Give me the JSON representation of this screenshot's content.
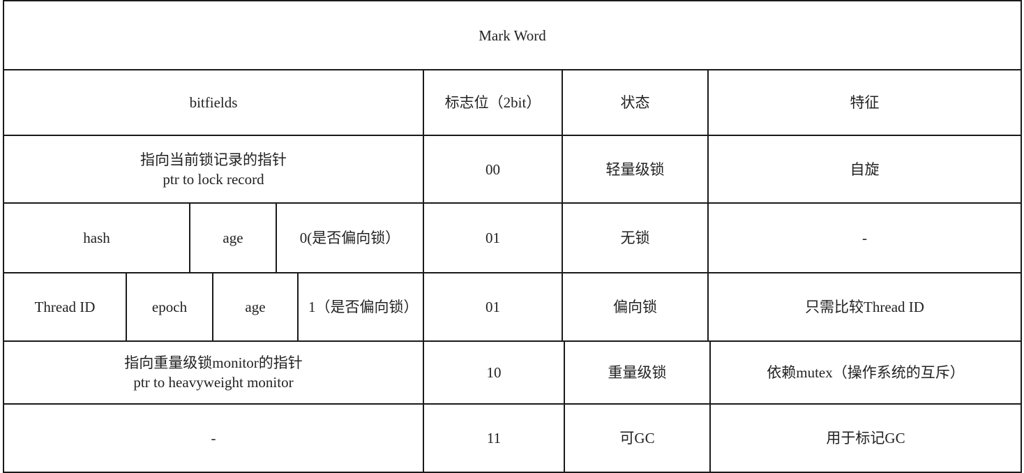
{
  "title": "Mark Word",
  "header": {
    "bitfields": "bitfields",
    "flag_bits": "标志位（2bit）",
    "state": "状态",
    "feature": "特征"
  },
  "rows": {
    "lightweight": {
      "bitfield_line1": "指向当前锁记录的指针",
      "bitfield_line2": "ptr to lock record",
      "flag": "00",
      "state": "轻量级锁",
      "feature": "自旋"
    },
    "unlocked": {
      "hash": "hash",
      "age": "age",
      "biased_flag": "0(是否偏向锁）",
      "flag": "01",
      "state": "无锁",
      "feature": "-"
    },
    "biased": {
      "thread_id": "Thread ID",
      "epoch": "epoch",
      "age": "age",
      "biased_flag": "1（是否偏向锁）",
      "flag": "01",
      "state": "偏向锁",
      "feature": "只需比较Thread ID"
    },
    "heavyweight": {
      "bitfield_line1": "指向重量级锁monitor的指针",
      "bitfield_line2": "ptr to heavyweight monitor",
      "flag": "10",
      "state": "重量级锁",
      "feature": "依赖mutex（操作系统的互斥）"
    },
    "gc": {
      "bitfield": "-",
      "flag": "11",
      "state": "可GC",
      "feature": "用于标记GC"
    }
  }
}
